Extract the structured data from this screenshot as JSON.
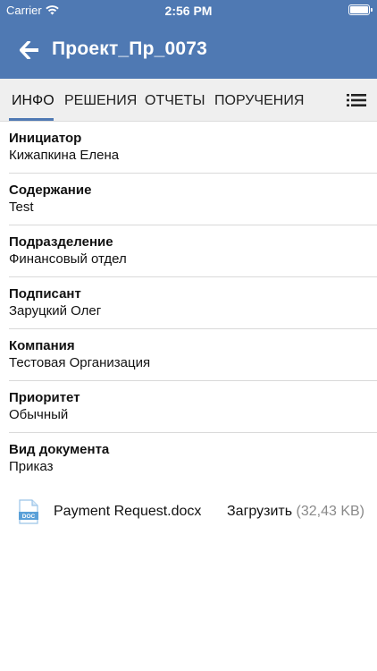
{
  "status_bar": {
    "carrier": "Carrier",
    "time": "2:56 PM"
  },
  "header": {
    "title": "Проект_Пр_0073",
    "back_icon": "arrow-left-icon"
  },
  "tabs": [
    {
      "label": "ИНФО",
      "active": true
    },
    {
      "label": "РЕШЕНИЯ",
      "active": false
    },
    {
      "label": "ОТЧЕТЫ",
      "active": false
    },
    {
      "label": "ПОРУЧЕНИЯ",
      "active": false
    }
  ],
  "tabs_menu_icon": "list-icon",
  "fields": [
    {
      "label": "Инициатор",
      "value": "Кижапкина Елена"
    },
    {
      "label": "Содержание",
      "value": "Test"
    },
    {
      "label": "Подразделение",
      "value": "Финансовый отдел"
    },
    {
      "label": "Подписант",
      "value": "Заруцкий Олег"
    },
    {
      "label": "Компания",
      "value": "Тестовая Организация"
    },
    {
      "label": "Приоритет",
      "value": "Обычный"
    },
    {
      "label": "Вид документа",
      "value": "Приказ"
    }
  ],
  "attachment": {
    "filename": "Payment Request.docx",
    "icon_label": "DOC",
    "download_label": "Загрузить",
    "size": "(32,43 KB)"
  },
  "colors": {
    "accent": "#4f79b3",
    "tab_bar_bg": "#efefef",
    "doc_icon": "#5aa0d8"
  }
}
